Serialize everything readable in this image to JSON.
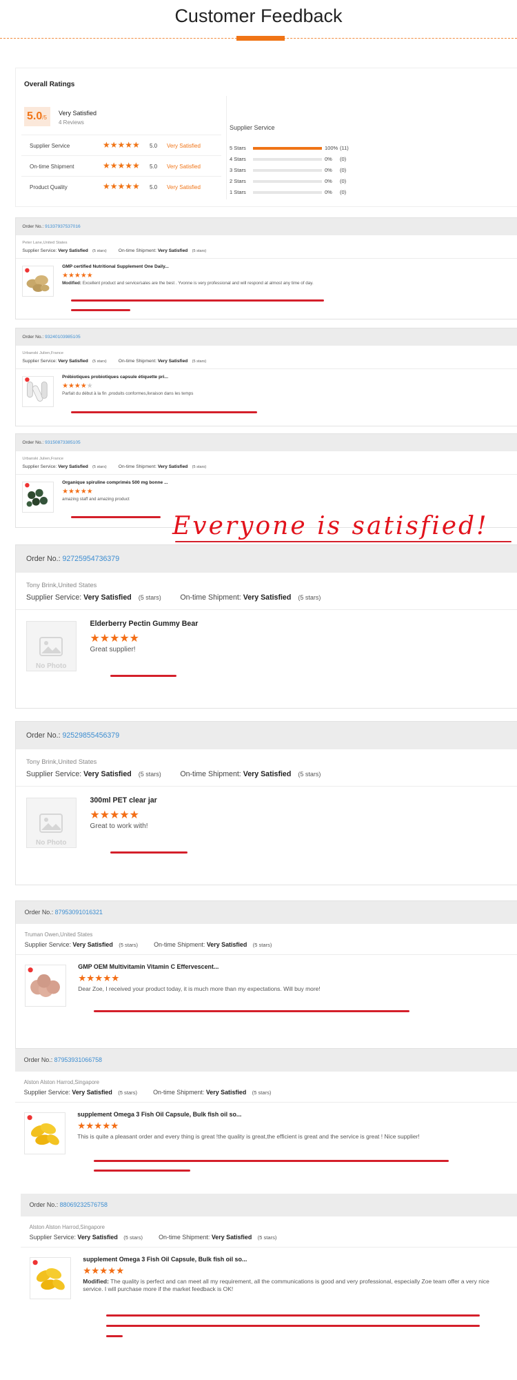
{
  "header": {
    "title": "Customer Feedback"
  },
  "overall": {
    "title": "Overall Ratings",
    "score": "5.0",
    "score_max": "/5",
    "label": "Very Satisfied",
    "reviews": "4 Reviews",
    "categories": [
      {
        "name": "Supplier Service",
        "stars": "★★★★★",
        "score": "5.0",
        "label": "Very Satisfied"
      },
      {
        "name": "On-time Shipment",
        "stars": "★★★★★",
        "score": "5.0",
        "label": "Very Satisfied"
      },
      {
        "name": "Product Quality",
        "stars": "★★★★★",
        "score": "5.0",
        "label": "Very Satisfied"
      }
    ],
    "supplier_title": "Supplier Service",
    "distribution": [
      {
        "label": "5 Stars",
        "fraction": 1.0,
        "pct": "100%",
        "count": "(11)"
      },
      {
        "label": "4 Stars",
        "fraction": 0,
        "pct": "0%",
        "count": "(0)"
      },
      {
        "label": "3 Stars",
        "fraction": 0,
        "pct": "0%",
        "count": "(0)"
      },
      {
        "label": "2 Stars",
        "fraction": 0,
        "pct": "0%",
        "count": "(0)"
      },
      {
        "label": "1 Stars",
        "fraction": 0,
        "pct": "0%",
        "count": "(0)"
      }
    ]
  },
  "common": {
    "order_label": "Order No.:",
    "supplier_service": "Supplier Service:",
    "ontime_shipment": "On-time Shipment:",
    "very_satisfied": "Very Satisfied",
    "five_stars": "(5 stars)",
    "no_photo": "No Photo"
  },
  "overlay_text": "Everyone is satisfied!",
  "reviews": [
    {
      "order": "91337937537016",
      "buyer": "Peter Lane,United States",
      "product": "GMP certified Nutritional Supplement One Daily...",
      "rating": 5,
      "modified": "Modified:",
      "comment": " Excellent product and service/sales are the best . Yvonne is very professional and will respond at almost any time of day."
    },
    {
      "order": "93240103985105",
      "buyer": "Urbanski Julien,France",
      "product": "Prébiotiques probiotiques capsule étiquette pri...",
      "rating": 4,
      "comment": "Parfait du début à la fin ,produits conformes,livraison dans les temps"
    },
    {
      "order": "93150873385105",
      "buyer": "Urbanski Julien,France",
      "product": "Organique spiruline comprimés 500 mg bonne ...",
      "rating": 5,
      "comment": "amazing staff and amazing product"
    },
    {
      "order": "92725954736379",
      "buyer": "Tony Brink,United States",
      "product": "Elderberry Pectin Gummy Bear",
      "rating": 5,
      "comment": "Great supplier!"
    },
    {
      "order": "92529855456379",
      "buyer": "Tony Brink,United States",
      "product": "300ml PET clear jar",
      "rating": 5,
      "comment": "Great to work with!"
    },
    {
      "order": "87953091016321",
      "buyer": "Truman Owen,United States",
      "product": "GMP OEM Multivitamin Vitamin C Effervescent...",
      "rating": 5,
      "comment": "Dear Zoe, I received your product today, it is much more than my expectations. Will buy more!"
    },
    {
      "order": "87953931066758",
      "buyer": "Alston Alston Harrod,Singapore",
      "product": "supplement Omega 3 Fish Oil Capsule, Bulk fish oil so...",
      "rating": 5,
      "comment": "This is quite a pleasant order and every thing is great !the quality is great,the efficient is great and the service is great ! Nice supplier!"
    },
    {
      "order": "88069232576758",
      "buyer": "Alston Alston Harrod,Singapore",
      "product": "supplement Omega 3 Fish Oil Capsule, Bulk fish oil so...",
      "rating": 5,
      "modified": "Modified:",
      "comment": " The quality is perfect and can meet all my requirement, all the communications is good and very professional, especially Zoe team offer a very nice service. I will purchase more if the market feedback is OK!"
    }
  ]
}
